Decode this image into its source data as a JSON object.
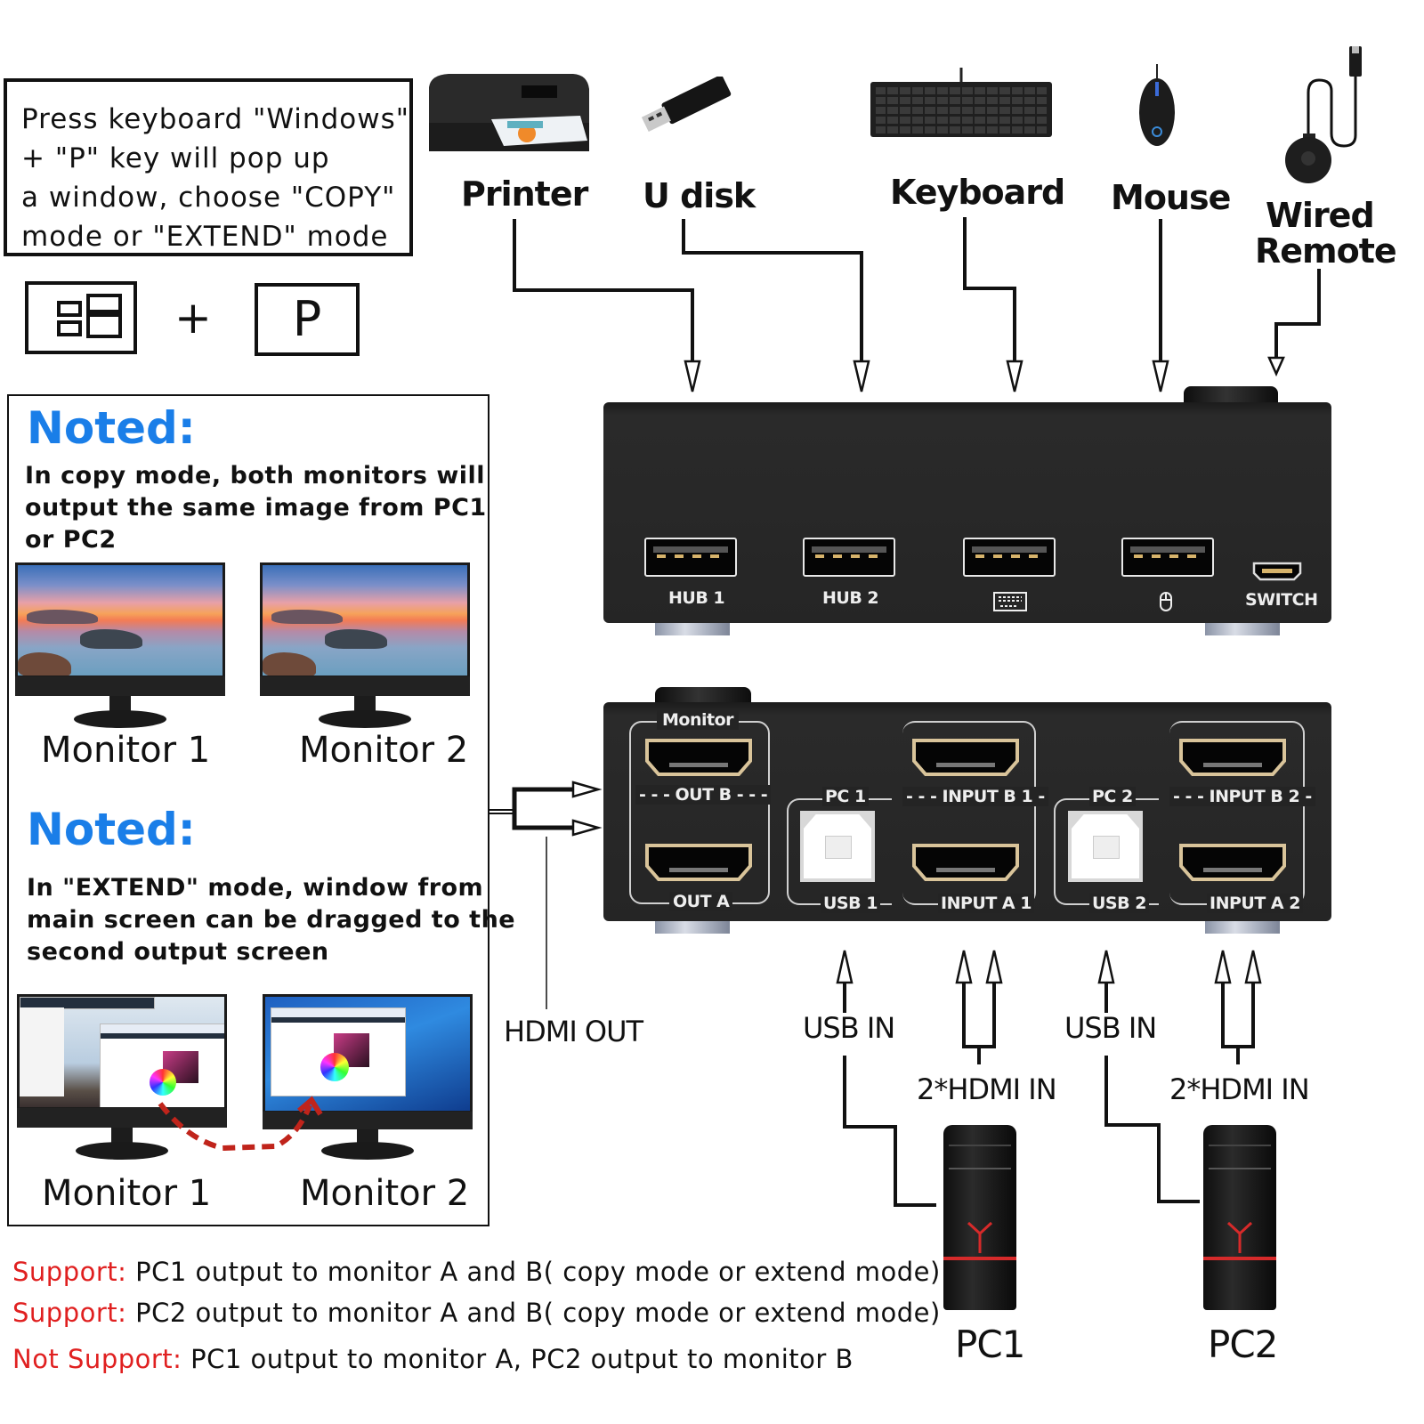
{
  "instructions": {
    "lines": [
      "Press keyboard \"Windows\"",
      "+ \"P\" key will pop up",
      "a window, choose \"COPY\"",
      "mode or \"EXTEND\" mode"
    ],
    "shortcut": {
      "key1_icon": "windows-key-icon",
      "plus": "+",
      "key2": "P"
    }
  },
  "notes": [
    {
      "heading": "Noted:",
      "lines": [
        "In copy mode, both monitors will",
        "output the same image from PC1",
        "or PC2"
      ],
      "monitors": [
        "Monitor 1",
        "Monitor 2"
      ]
    },
    {
      "heading": "Noted:",
      "lines": [
        "In \"EXTEND\" mode, window from",
        "main screen can be dragged to the",
        "second output screen"
      ],
      "monitors": [
        "Monitor 1",
        "Monitor 2"
      ]
    }
  ],
  "support": [
    {
      "tag": "Support:",
      "text": "PC1 output to monitor A and B( copy mode or extend mode)"
    },
    {
      "tag": "Support:",
      "text": "PC2 output to monitor A and B( copy mode or extend mode)"
    },
    {
      "tag": "Not Support:",
      "text": "PC1 output to monitor A, PC2 output to monitor B"
    }
  ],
  "devices": [
    {
      "label": "Printer",
      "icon": "printer-icon"
    },
    {
      "label": "U disk",
      "icon": "usb-drive-icon"
    },
    {
      "label": "Keyboard",
      "icon": "keyboard-icon"
    },
    {
      "label": "Mouse",
      "icon": "mouse-icon"
    },
    {
      "label": "Wired",
      "label2": "Remote",
      "icon": "wired-remote-icon"
    }
  ],
  "front_panel": {
    "ports": [
      "HUB 1",
      "HUB 2",
      "keyboard-port",
      "mouse-port",
      "SWITCH"
    ]
  },
  "rear_panel": {
    "monitor_group": "Monitor",
    "out_b": "OUT B",
    "out_a": "OUT A",
    "pc1": "PC 1",
    "pc2": "PC 2",
    "input_b1": "INPUT B 1",
    "input_a1": "INPUT A 1",
    "input_b2": "INPUT B 2",
    "input_a2": "INPUT A 2",
    "usb1": "USB 1",
    "usb2": "USB 2"
  },
  "flow": {
    "hdmi_out": "HDMI OUT",
    "usb_in": "USB IN",
    "hdmi_in": "2*HDMI IN"
  },
  "pcs": [
    "PC1",
    "PC2"
  ],
  "colors": {
    "noted_blue": "#1a7ee8",
    "support_red": "#e02020",
    "port_gold": "#d6b36b",
    "drag_arrow_red": "#c0241b"
  }
}
